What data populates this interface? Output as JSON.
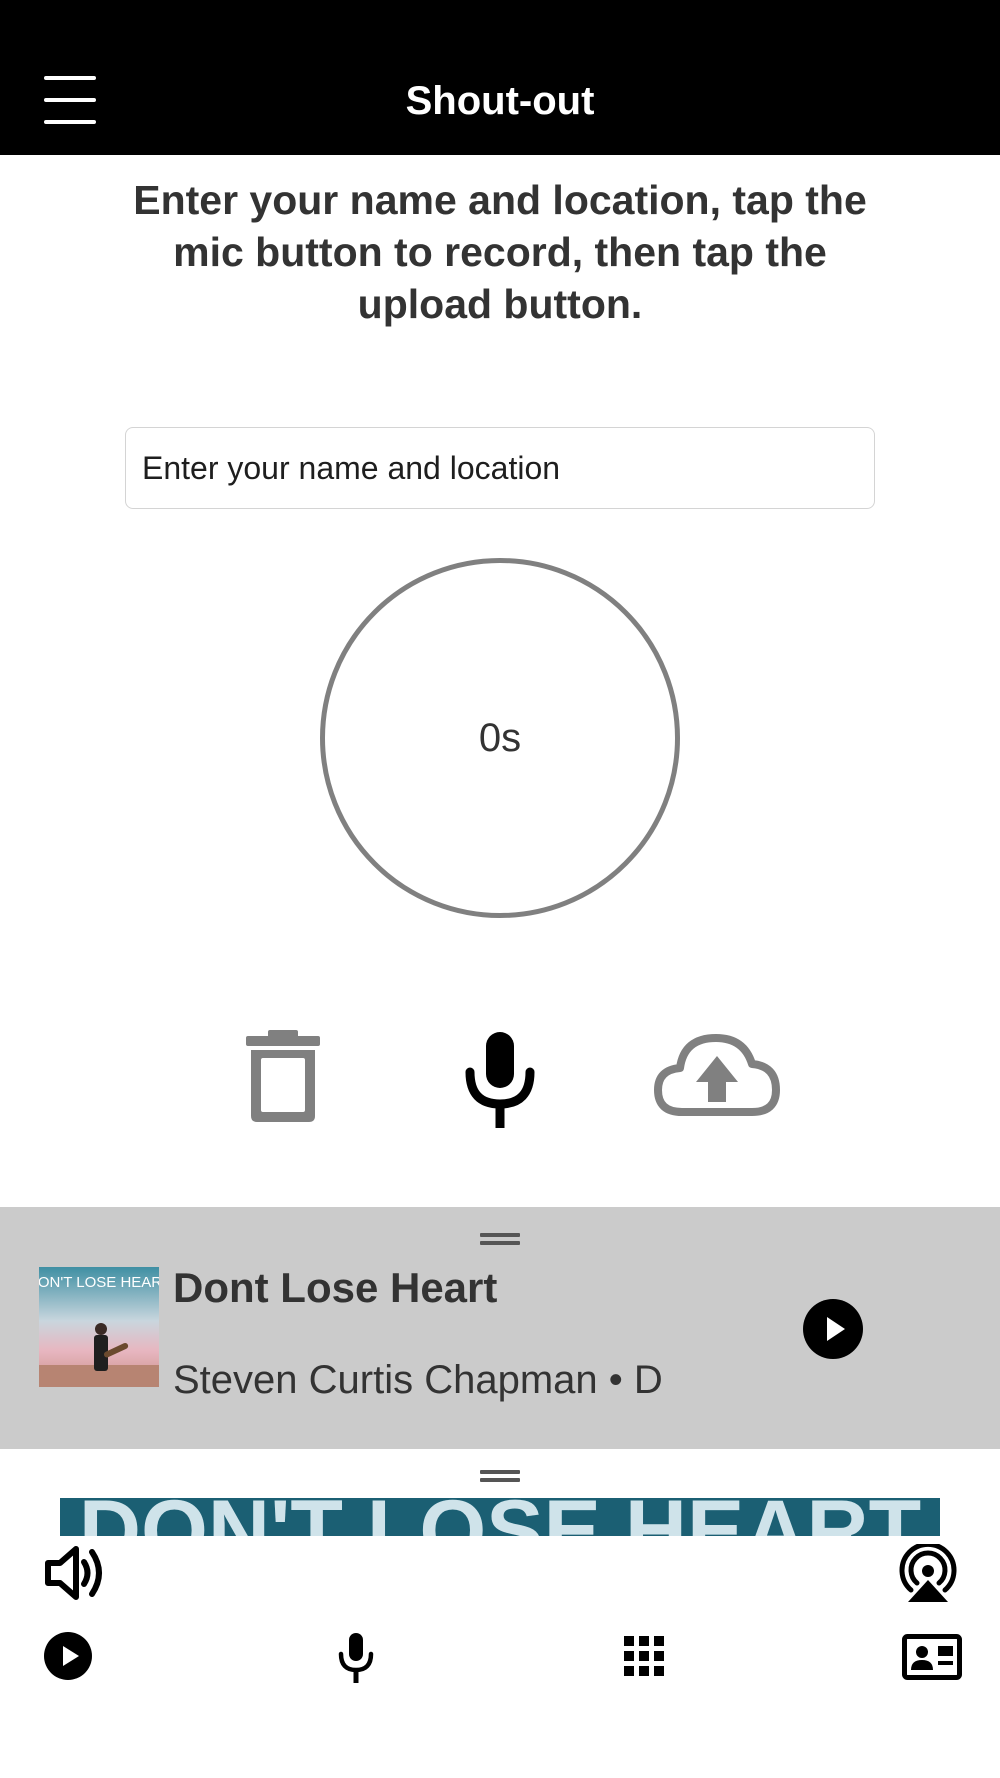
{
  "header": {
    "title": "Shout-out",
    "menu_icon": "hamburger-menu-icon"
  },
  "instructions": "Enter your name and location, tap the mic button to record, then tap the upload button.",
  "name_input": {
    "placeholder": "Enter your name and location",
    "value": ""
  },
  "recorder": {
    "elapsed": "0s",
    "controls": [
      {
        "name": "delete",
        "icon": "trash-icon"
      },
      {
        "name": "record",
        "icon": "microphone-icon"
      },
      {
        "name": "upload",
        "icon": "cloud-upload-icon"
      }
    ]
  },
  "now_playing": {
    "title": "Dont Lose Heart",
    "subtitle": "Steven Curtis Chapman • D",
    "album_art_text": "DON'T LOSE HEART",
    "play_icon": "play-circle-icon",
    "background": "#cbcbcb"
  },
  "banner": {
    "text": "DON'T LOSE HEART",
    "color": "#1b5f73"
  },
  "toolbar": {
    "top_row": [
      {
        "name": "volume",
        "icon": "speaker-icon"
      },
      {
        "name": "airplay",
        "icon": "airplay-icon"
      }
    ],
    "tabs": [
      {
        "name": "player",
        "icon": "play-circle-icon"
      },
      {
        "name": "shout-out",
        "icon": "microphone-icon"
      },
      {
        "name": "menu-grid",
        "icon": "grid-icon"
      },
      {
        "name": "contact",
        "icon": "contact-card-icon"
      }
    ]
  }
}
